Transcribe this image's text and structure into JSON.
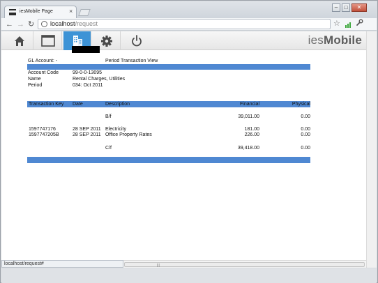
{
  "browser": {
    "tab_title": "iesMobile Page",
    "tab_close": "×",
    "url_host": "localhost",
    "url_path": "/request",
    "status_url": "localhost/request#",
    "back_glyph": "←",
    "forward_glyph": "→",
    "reload_glyph": "↻",
    "star_glyph": "☆",
    "wrench_glyph": "🔧",
    "min_glyph": "–",
    "max_glyph": "□",
    "close_glyph": "✕"
  },
  "app": {
    "brand_light": "ies",
    "brand_bold": "Mobile",
    "nav": [
      {
        "icon": "home-icon"
      },
      {
        "icon": "window-icon"
      },
      {
        "icon": "reports-icon",
        "active": true
      },
      {
        "icon": "gear-icon"
      },
      {
        "icon": "power-icon"
      }
    ],
    "accent": "#3d93d6"
  },
  "report": {
    "gl_account_label": "GL Account: -",
    "view_title": "Period Transaction View",
    "details": [
      {
        "label": "Account Code",
        "value": "99-0-0-13095"
      },
      {
        "label": "Name",
        "value": "Rental Charges, Utilities"
      },
      {
        "label": "Period",
        "value": "034: Oct 2011"
      }
    ],
    "columns": {
      "key": "Transaction Key",
      "date": "Date",
      "description": "Description",
      "financial": "Financial",
      "physical": "Physical"
    },
    "brought_forward": {
      "description": "B/f",
      "financial": "39,011.00",
      "physical": "0.00"
    },
    "rows": [
      {
        "key": "1597747176",
        "date": "28 SEP 2011",
        "description": "Electricity",
        "financial": "181.00",
        "physical": "0.00"
      },
      {
        "key": "1597747205B",
        "date": "28 SEP 2011",
        "description": "Office Property Rates",
        "financial": "226.00",
        "physical": "0.00"
      }
    ],
    "carried_forward": {
      "description": "C/f",
      "financial": "39,418.00",
      "physical": "0.00"
    },
    "bar_color": "#4f88d2"
  }
}
